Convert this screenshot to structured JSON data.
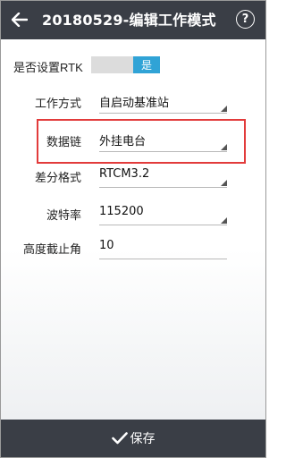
{
  "header": {
    "title": "20180529-编辑工作模式",
    "back_icon": "arrow-left-icon",
    "help_label": "?"
  },
  "rtk": {
    "label": "是否设置RTK",
    "toggle_value": "是"
  },
  "fields": {
    "work_mode": {
      "label": "工作方式",
      "value": "自启动基准站"
    },
    "data_link": {
      "label": "数据链",
      "value": "外挂电台"
    },
    "diff_format": {
      "label": "差分格式",
      "value": "RTCM3.2"
    },
    "baud_rate": {
      "label": "波特率",
      "value": "115200"
    },
    "elevation_mask": {
      "label": "高度截止角",
      "value": "10"
    }
  },
  "footer": {
    "save_label": "保存",
    "save_icon": "check-icon"
  },
  "colors": {
    "header_bg": "#3a3e46",
    "toggle_on": "#30a3d6",
    "highlight": "#e23b3b"
  }
}
